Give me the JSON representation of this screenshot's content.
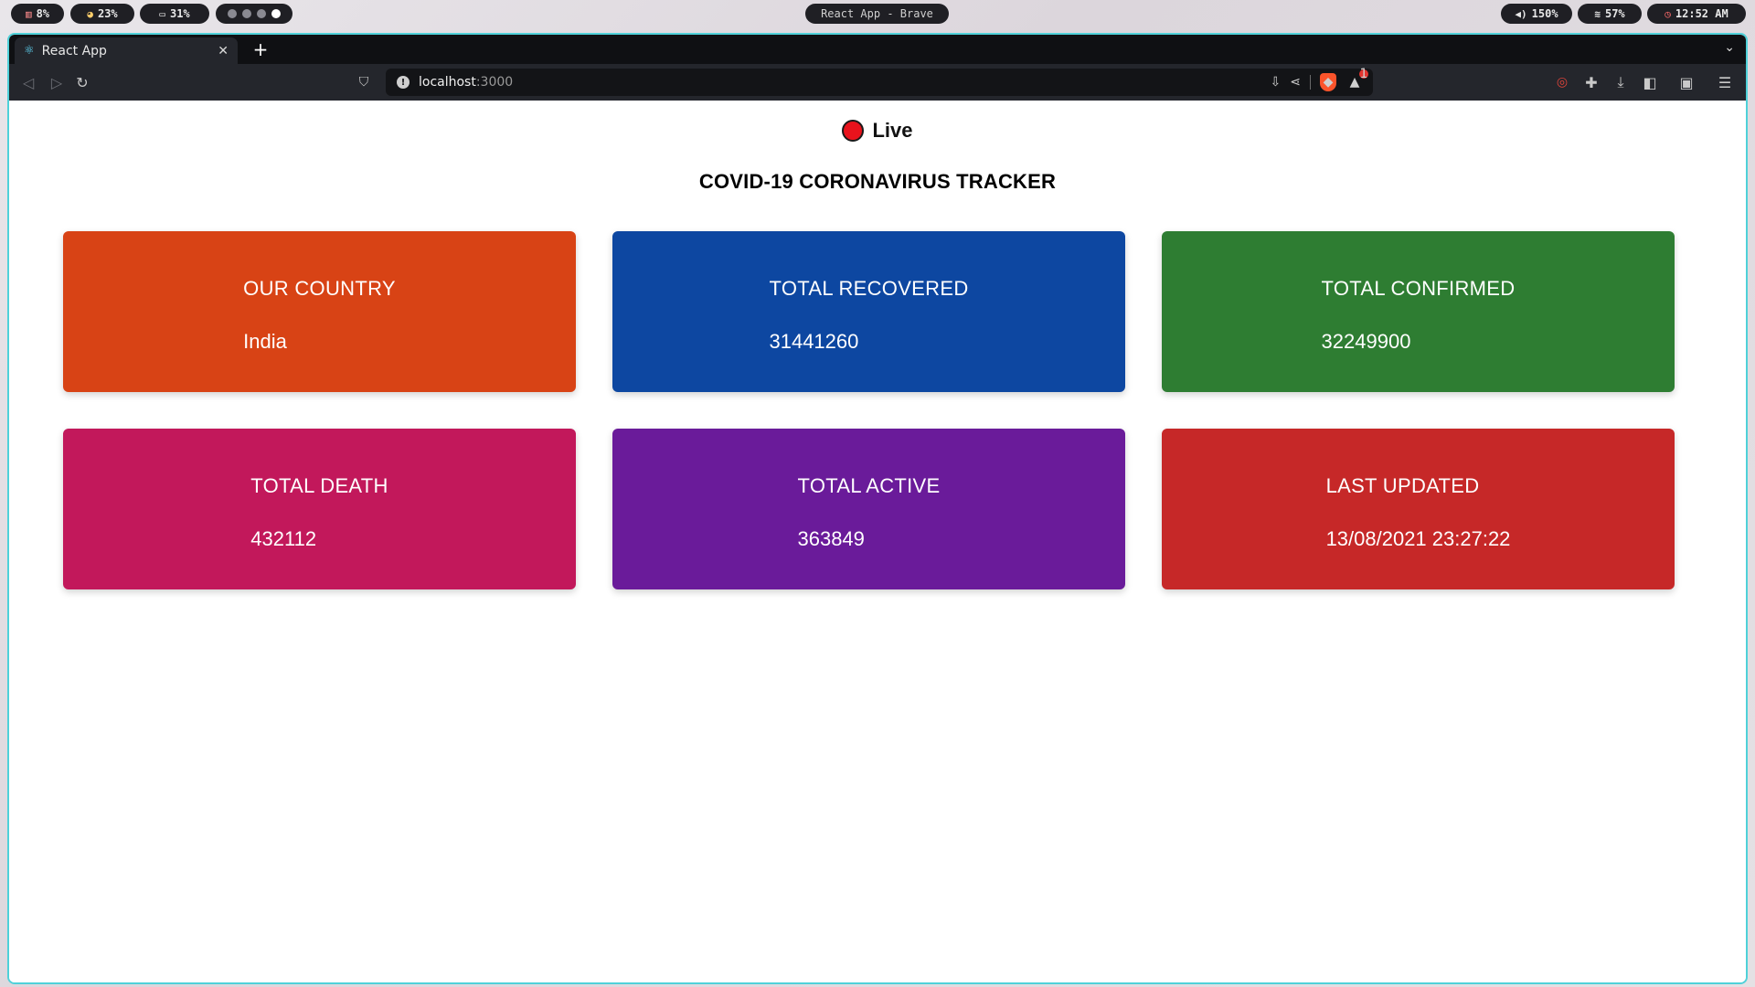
{
  "system_bar": {
    "cpu": "8%",
    "memory": "23%",
    "battery": "31%",
    "window_title": "React App - Brave",
    "volume": "150%",
    "wifi": "57%",
    "clock": "12:52 AM"
  },
  "browser": {
    "tab_title": "React App",
    "url_host": "localhost",
    "url_port": ":3000"
  },
  "page": {
    "live_label": "Live",
    "title": "COVID-19 CORONAVIRUS TRACKER",
    "cards": [
      {
        "label": "OUR COUNTRY",
        "value": "India",
        "color": "#d84315"
      },
      {
        "label": "TOTAL RECOVERED",
        "value": "31441260",
        "color": "#0d47a1"
      },
      {
        "label": "TOTAL CONFIRMED",
        "value": "32249900",
        "color": "#2e7d32"
      },
      {
        "label": "TOTAL DEATH",
        "value": "432112",
        "color": "#c2185b"
      },
      {
        "label": "TOTAL ACTIVE",
        "value": "363849",
        "color": "#6a1b9a"
      },
      {
        "label": "LAST UPDATED",
        "value": "13/08/2021 23:27:22",
        "color": "#c62828"
      }
    ]
  }
}
